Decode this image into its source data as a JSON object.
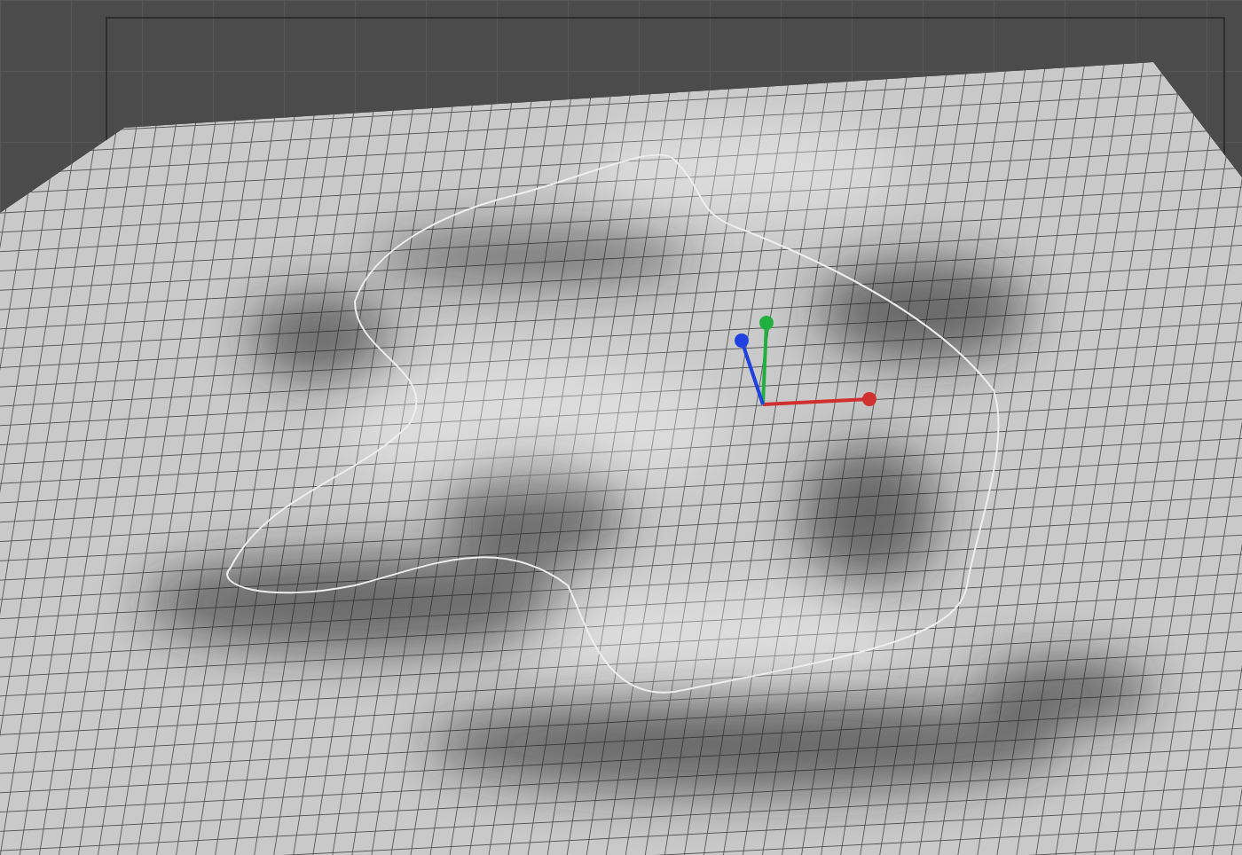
{
  "gizmo": {
    "axes": [
      {
        "kind": "x",
        "color": "#d03030"
      },
      {
        "kind": "y",
        "color": "#20b040"
      },
      {
        "kind": "z",
        "color": "#2040e0"
      }
    ]
  }
}
